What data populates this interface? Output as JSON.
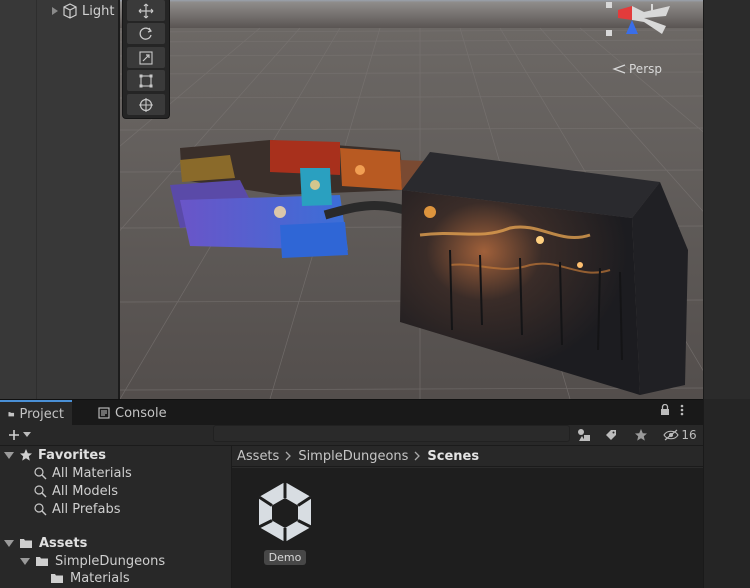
{
  "hierarchy": {
    "item_label": "Light"
  },
  "scene": {
    "projection_label": "Persp"
  },
  "tabs": [
    {
      "label": "Project",
      "active": true
    },
    {
      "label": "Console",
      "active": false
    }
  ],
  "search": {
    "value": "",
    "placeholder": ""
  },
  "toolbar": {
    "hidden_count": "16"
  },
  "favorites": {
    "header": "Favorites",
    "items": [
      "All Materials",
      "All Models",
      "All Prefabs"
    ]
  },
  "assets": {
    "header": "Assets",
    "folder": "SimpleDungeons",
    "subfolder": "Materials"
  },
  "breadcrumb": {
    "root": "Assets",
    "middle": "SimpleDungeons",
    "current": "Scenes"
  },
  "files": [
    {
      "label": "Demo",
      "icon": "unity-scene-icon"
    }
  ],
  "colors": {
    "accent": "#4a90d6",
    "scene_bg": "#595553",
    "panel_bg": "#282828"
  }
}
